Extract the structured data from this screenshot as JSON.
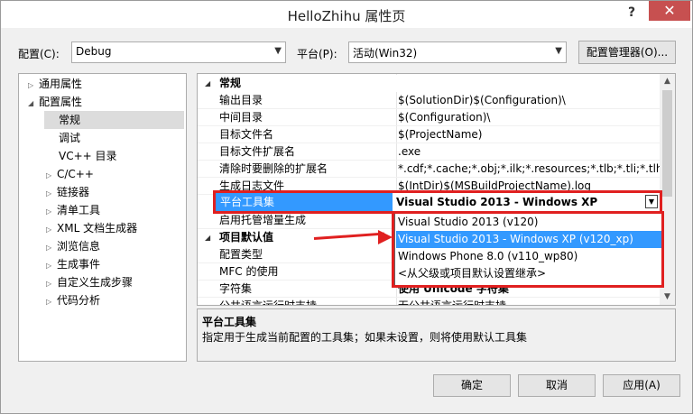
{
  "window": {
    "title": "HelloZhihu 属性页",
    "help": "?",
    "close": "✕"
  },
  "config": {
    "label": "配置(C):",
    "value": "Debug"
  },
  "platform": {
    "label": "平台(P):",
    "value": "活动(Win32)"
  },
  "buttons": {
    "config_manager": "配置管理器(O)...",
    "ok": "确定",
    "cancel": "取消",
    "apply": "应用(A)"
  },
  "tree": [
    "通用属性",
    "配置属性",
    "常规",
    "调试",
    "VC++ 目录",
    "C/C++",
    "链接器",
    "清单工具",
    "XML 文档生成器",
    "浏览信息",
    "生成事件",
    "自定义生成步骤",
    "代码分析"
  ],
  "grid": {
    "cat_general": "常规",
    "cat_defaults": "项目默认值",
    "rows": [
      {
        "name": "输出目录",
        "value": "$(SolutionDir)$(Configuration)\\"
      },
      {
        "name": "中间目录",
        "value": "$(Configuration)\\"
      },
      {
        "name": "目标文件名",
        "value": "$(ProjectName)"
      },
      {
        "name": "目标文件扩展名",
        "value": ".exe"
      },
      {
        "name": "清除时要删除的扩展名",
        "value": "*.cdf;*.cache;*.obj;*.ilk;*.resources;*.tlb;*.tli;*.tlh;*.tm"
      },
      {
        "name": "生成日志文件",
        "value": "$(IntDir)$(MSBuildProjectName).log"
      },
      {
        "name": "平台工具集",
        "value": "Visual Studio 2013 - Windows XP (v120_xp)"
      },
      {
        "name": "启用托管增量生成",
        "value": ""
      },
      {
        "name": "配置类型",
        "value": ""
      },
      {
        "name": "MFC 的使用",
        "value": ""
      },
      {
        "name": "字符集",
        "value": "使用 Unicode 字符集"
      },
      {
        "name": "公共语言运行时支持",
        "value": "无公共语言运行时支持"
      }
    ]
  },
  "dropdown": [
    "Visual Studio 2013 (v120)",
    "Visual Studio 2013 - Windows XP (v120_xp)",
    "Windows Phone 8.0 (v110_wp80)",
    "<从父级或项目默认设置继承>"
  ],
  "description": {
    "title": "平台工具集",
    "text": "指定用于生成当前配置的工具集；如果未设置，则将使用默认工具集"
  },
  "colors": {
    "selection": "#3399ff",
    "annotation": "#e02020",
    "close": "#c75050"
  }
}
